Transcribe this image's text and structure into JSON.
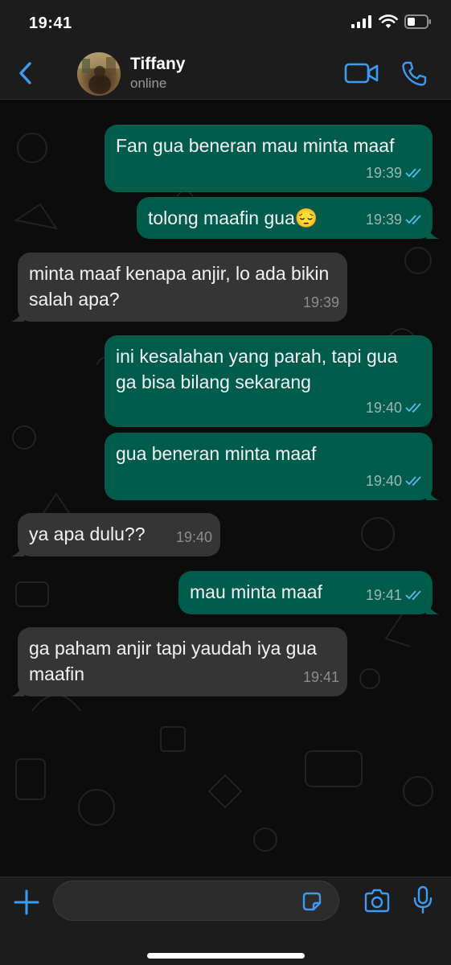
{
  "status_bar": {
    "time": "19:41"
  },
  "header": {
    "contact_name": "Tiffany",
    "status": "online"
  },
  "messages": [
    {
      "direction": "out",
      "text": "Fan gua beneran mau minta maaf",
      "time": "19:39",
      "read": true
    },
    {
      "direction": "out",
      "text": "tolong maafin gua😔",
      "time": "19:39",
      "read": true
    },
    {
      "direction": "in",
      "text": "minta maaf kenapa anjir, lo ada bikin salah apa?",
      "time": "19:39"
    },
    {
      "direction": "out",
      "text": "ini kesalahan yang parah, tapi gua ga bisa bilang sekarang",
      "time": "19:40",
      "read": true
    },
    {
      "direction": "out",
      "text": "gua beneran minta maaf",
      "time": "19:40",
      "read": true
    },
    {
      "direction": "in",
      "text": "ya apa dulu??",
      "time": "19:40"
    },
    {
      "direction": "out",
      "text": "mau minta maaf",
      "time": "19:41",
      "read": true
    },
    {
      "direction": "in",
      "text": "ga paham anjir tapi yaudah iya gua maafin",
      "time": "19:41"
    }
  ],
  "input": {
    "value": "",
    "placeholder": ""
  },
  "icons": {
    "back": "chevron-left-icon",
    "video": "video-camera-icon",
    "call": "phone-icon",
    "add": "plus-icon",
    "sticker": "sticker-icon",
    "camera": "camera-icon",
    "mic": "microphone-icon",
    "read": "double-check-icon"
  },
  "colors": {
    "accent": "#3b9bf5",
    "outgoing_bubble": "#005c4b",
    "incoming_bubble": "#353535",
    "read_tick": "#53bdeb"
  }
}
